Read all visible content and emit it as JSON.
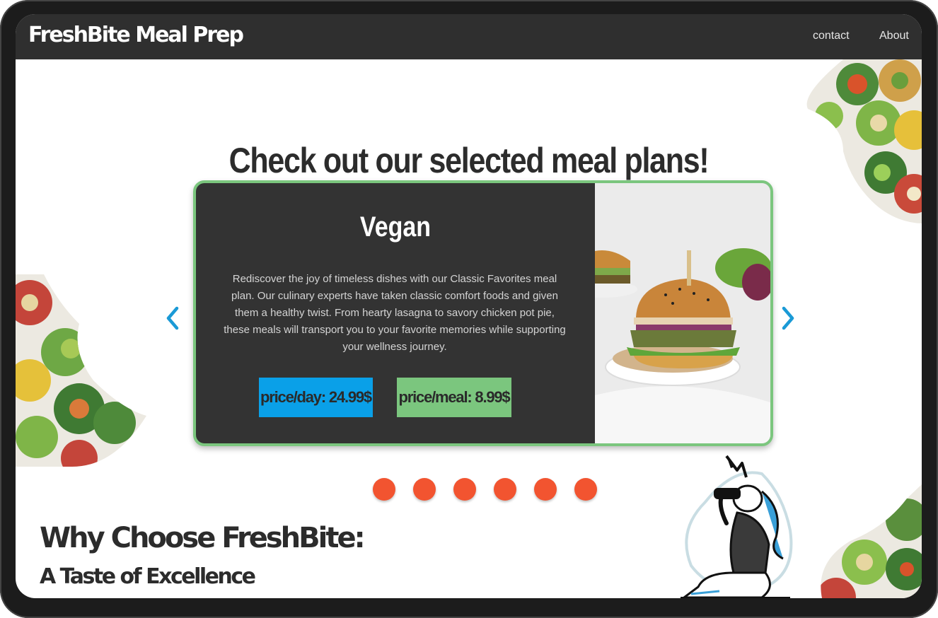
{
  "header": {
    "logo": "FreshBite Meal Prep",
    "nav": [
      {
        "label": "contact"
      },
      {
        "label": "About"
      }
    ]
  },
  "main": {
    "heading": "Check out our selected meal plans!",
    "carousel": {
      "active_index": 0,
      "slide_count": 6,
      "slide": {
        "title": "Vegan",
        "description": "Rediscover the joy of timeless dishes with our Classic Favorites meal plan. Our culinary experts have taken classic comfort foods and given them a healthy twist. From hearty lasagna to savory chicken pot pie, these meals will transport you to your favorite memories while supporting your wellness journey.",
        "price_day": "price/day: 24.99$",
        "price_meal": "price/meal: 8.99$",
        "image": "veggie-burger-photo"
      },
      "prev_icon": "chevron-left-icon",
      "next_icon": "chevron-right-icon"
    }
  },
  "why": {
    "title": "Why Choose FreshBite:",
    "subtitle": "A Taste of Excellence"
  },
  "colors": {
    "nav_bg": "#2f2f2f",
    "card_bg": "#333333",
    "card_border": "#7bc67e",
    "price_day_bg": "#0aa0e8",
    "price_meal_bg": "#7bc67e",
    "dot": "#f25430",
    "arrow": "#1a9ad6"
  }
}
